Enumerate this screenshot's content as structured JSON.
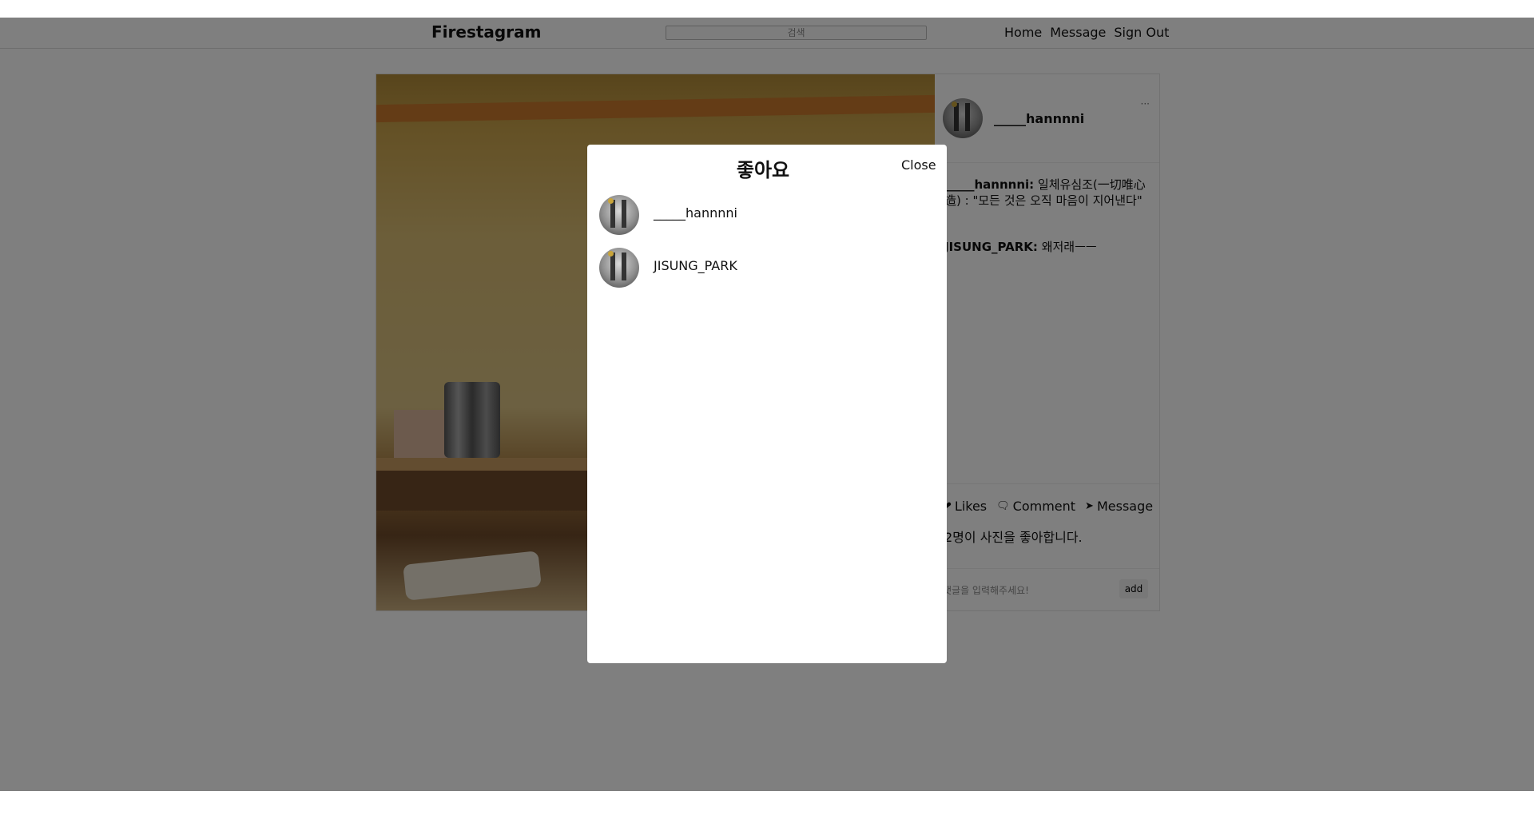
{
  "navbar": {
    "brand": "Firestagram",
    "search_placeholder": "검색",
    "links": [
      "Home",
      "Message",
      "Sign Out"
    ]
  },
  "post": {
    "author": "_____hannnni",
    "more_label": "···",
    "comments": [
      {
        "user": "_____hannnni:",
        "text": " 일체유심조(一切唯心造) : \"모든 것은 오직 마음이 지어낸다\""
      },
      {
        "user": "JISUNG_PARK:",
        "text": " 왜저래ㅡㅡ"
      }
    ],
    "actions": {
      "likes_label": "Likes",
      "comment_label": "Comment",
      "message_label": "Message"
    },
    "likes_text": "2명이 사진을 좋아합니다.",
    "comment_placeholder": "댓글을 입력해주세요!",
    "add_label": "add"
  },
  "modal": {
    "title": "좋아요",
    "close_label": "Close",
    "users": [
      "_____hannnni",
      "JISUNG_PARK"
    ]
  },
  "icons": {
    "heart": "heart-icon",
    "comment": "comment-icon",
    "send": "send-icon"
  }
}
